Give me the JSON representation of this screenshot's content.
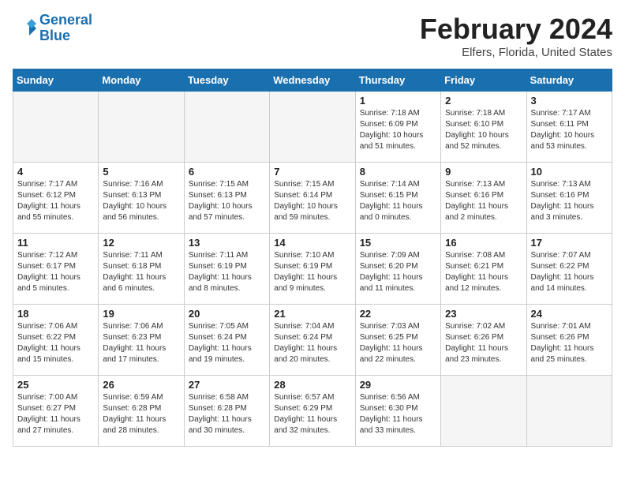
{
  "header": {
    "logo_line1": "General",
    "logo_line2": "Blue",
    "month_title": "February 2024",
    "location": "Elfers, Florida, United States"
  },
  "weekdays": [
    "Sunday",
    "Monday",
    "Tuesday",
    "Wednesday",
    "Thursday",
    "Friday",
    "Saturday"
  ],
  "weeks": [
    [
      {
        "day": "",
        "empty": true
      },
      {
        "day": "",
        "empty": true
      },
      {
        "day": "",
        "empty": true
      },
      {
        "day": "",
        "empty": true
      },
      {
        "day": "1",
        "sunrise": "7:18 AM",
        "sunset": "6:09 PM",
        "daylight": "10 hours and 51 minutes."
      },
      {
        "day": "2",
        "sunrise": "7:18 AM",
        "sunset": "6:10 PM",
        "daylight": "10 hours and 52 minutes."
      },
      {
        "day": "3",
        "sunrise": "7:17 AM",
        "sunset": "6:11 PM",
        "daylight": "10 hours and 53 minutes."
      }
    ],
    [
      {
        "day": "4",
        "sunrise": "7:17 AM",
        "sunset": "6:12 PM",
        "daylight": "11 hours and 55 minutes."
      },
      {
        "day": "5",
        "sunrise": "7:16 AM",
        "sunset": "6:13 PM",
        "daylight": "10 hours and 56 minutes."
      },
      {
        "day": "6",
        "sunrise": "7:15 AM",
        "sunset": "6:13 PM",
        "daylight": "10 hours and 57 minutes."
      },
      {
        "day": "7",
        "sunrise": "7:15 AM",
        "sunset": "6:14 PM",
        "daylight": "10 hours and 59 minutes."
      },
      {
        "day": "8",
        "sunrise": "7:14 AM",
        "sunset": "6:15 PM",
        "daylight": "11 hours and 0 minutes."
      },
      {
        "day": "9",
        "sunrise": "7:13 AM",
        "sunset": "6:16 PM",
        "daylight": "11 hours and 2 minutes."
      },
      {
        "day": "10",
        "sunrise": "7:13 AM",
        "sunset": "6:16 PM",
        "daylight": "11 hours and 3 minutes."
      }
    ],
    [
      {
        "day": "11",
        "sunrise": "7:12 AM",
        "sunset": "6:17 PM",
        "daylight": "11 hours and 5 minutes."
      },
      {
        "day": "12",
        "sunrise": "7:11 AM",
        "sunset": "6:18 PM",
        "daylight": "11 hours and 6 minutes."
      },
      {
        "day": "13",
        "sunrise": "7:11 AM",
        "sunset": "6:19 PM",
        "daylight": "11 hours and 8 minutes."
      },
      {
        "day": "14",
        "sunrise": "7:10 AM",
        "sunset": "6:19 PM",
        "daylight": "11 hours and 9 minutes."
      },
      {
        "day": "15",
        "sunrise": "7:09 AM",
        "sunset": "6:20 PM",
        "daylight": "11 hours and 11 minutes."
      },
      {
        "day": "16",
        "sunrise": "7:08 AM",
        "sunset": "6:21 PM",
        "daylight": "11 hours and 12 minutes."
      },
      {
        "day": "17",
        "sunrise": "7:07 AM",
        "sunset": "6:22 PM",
        "daylight": "11 hours and 14 minutes."
      }
    ],
    [
      {
        "day": "18",
        "sunrise": "7:06 AM",
        "sunset": "6:22 PM",
        "daylight": "11 hours and 15 minutes."
      },
      {
        "day": "19",
        "sunrise": "7:06 AM",
        "sunset": "6:23 PM",
        "daylight": "11 hours and 17 minutes."
      },
      {
        "day": "20",
        "sunrise": "7:05 AM",
        "sunset": "6:24 PM",
        "daylight": "11 hours and 19 minutes."
      },
      {
        "day": "21",
        "sunrise": "7:04 AM",
        "sunset": "6:24 PM",
        "daylight": "11 hours and 20 minutes."
      },
      {
        "day": "22",
        "sunrise": "7:03 AM",
        "sunset": "6:25 PM",
        "daylight": "11 hours and 22 minutes."
      },
      {
        "day": "23",
        "sunrise": "7:02 AM",
        "sunset": "6:26 PM",
        "daylight": "11 hours and 23 minutes."
      },
      {
        "day": "24",
        "sunrise": "7:01 AM",
        "sunset": "6:26 PM",
        "daylight": "11 hours and 25 minutes."
      }
    ],
    [
      {
        "day": "25",
        "sunrise": "7:00 AM",
        "sunset": "6:27 PM",
        "daylight": "11 hours and 27 minutes."
      },
      {
        "day": "26",
        "sunrise": "6:59 AM",
        "sunset": "6:28 PM",
        "daylight": "11 hours and 28 minutes."
      },
      {
        "day": "27",
        "sunrise": "6:58 AM",
        "sunset": "6:28 PM",
        "daylight": "11 hours and 30 minutes."
      },
      {
        "day": "28",
        "sunrise": "6:57 AM",
        "sunset": "6:29 PM",
        "daylight": "11 hours and 32 minutes."
      },
      {
        "day": "29",
        "sunrise": "6:56 AM",
        "sunset": "6:30 PM",
        "daylight": "11 hours and 33 minutes."
      },
      {
        "day": "",
        "empty": true
      },
      {
        "day": "",
        "empty": true
      }
    ]
  ]
}
